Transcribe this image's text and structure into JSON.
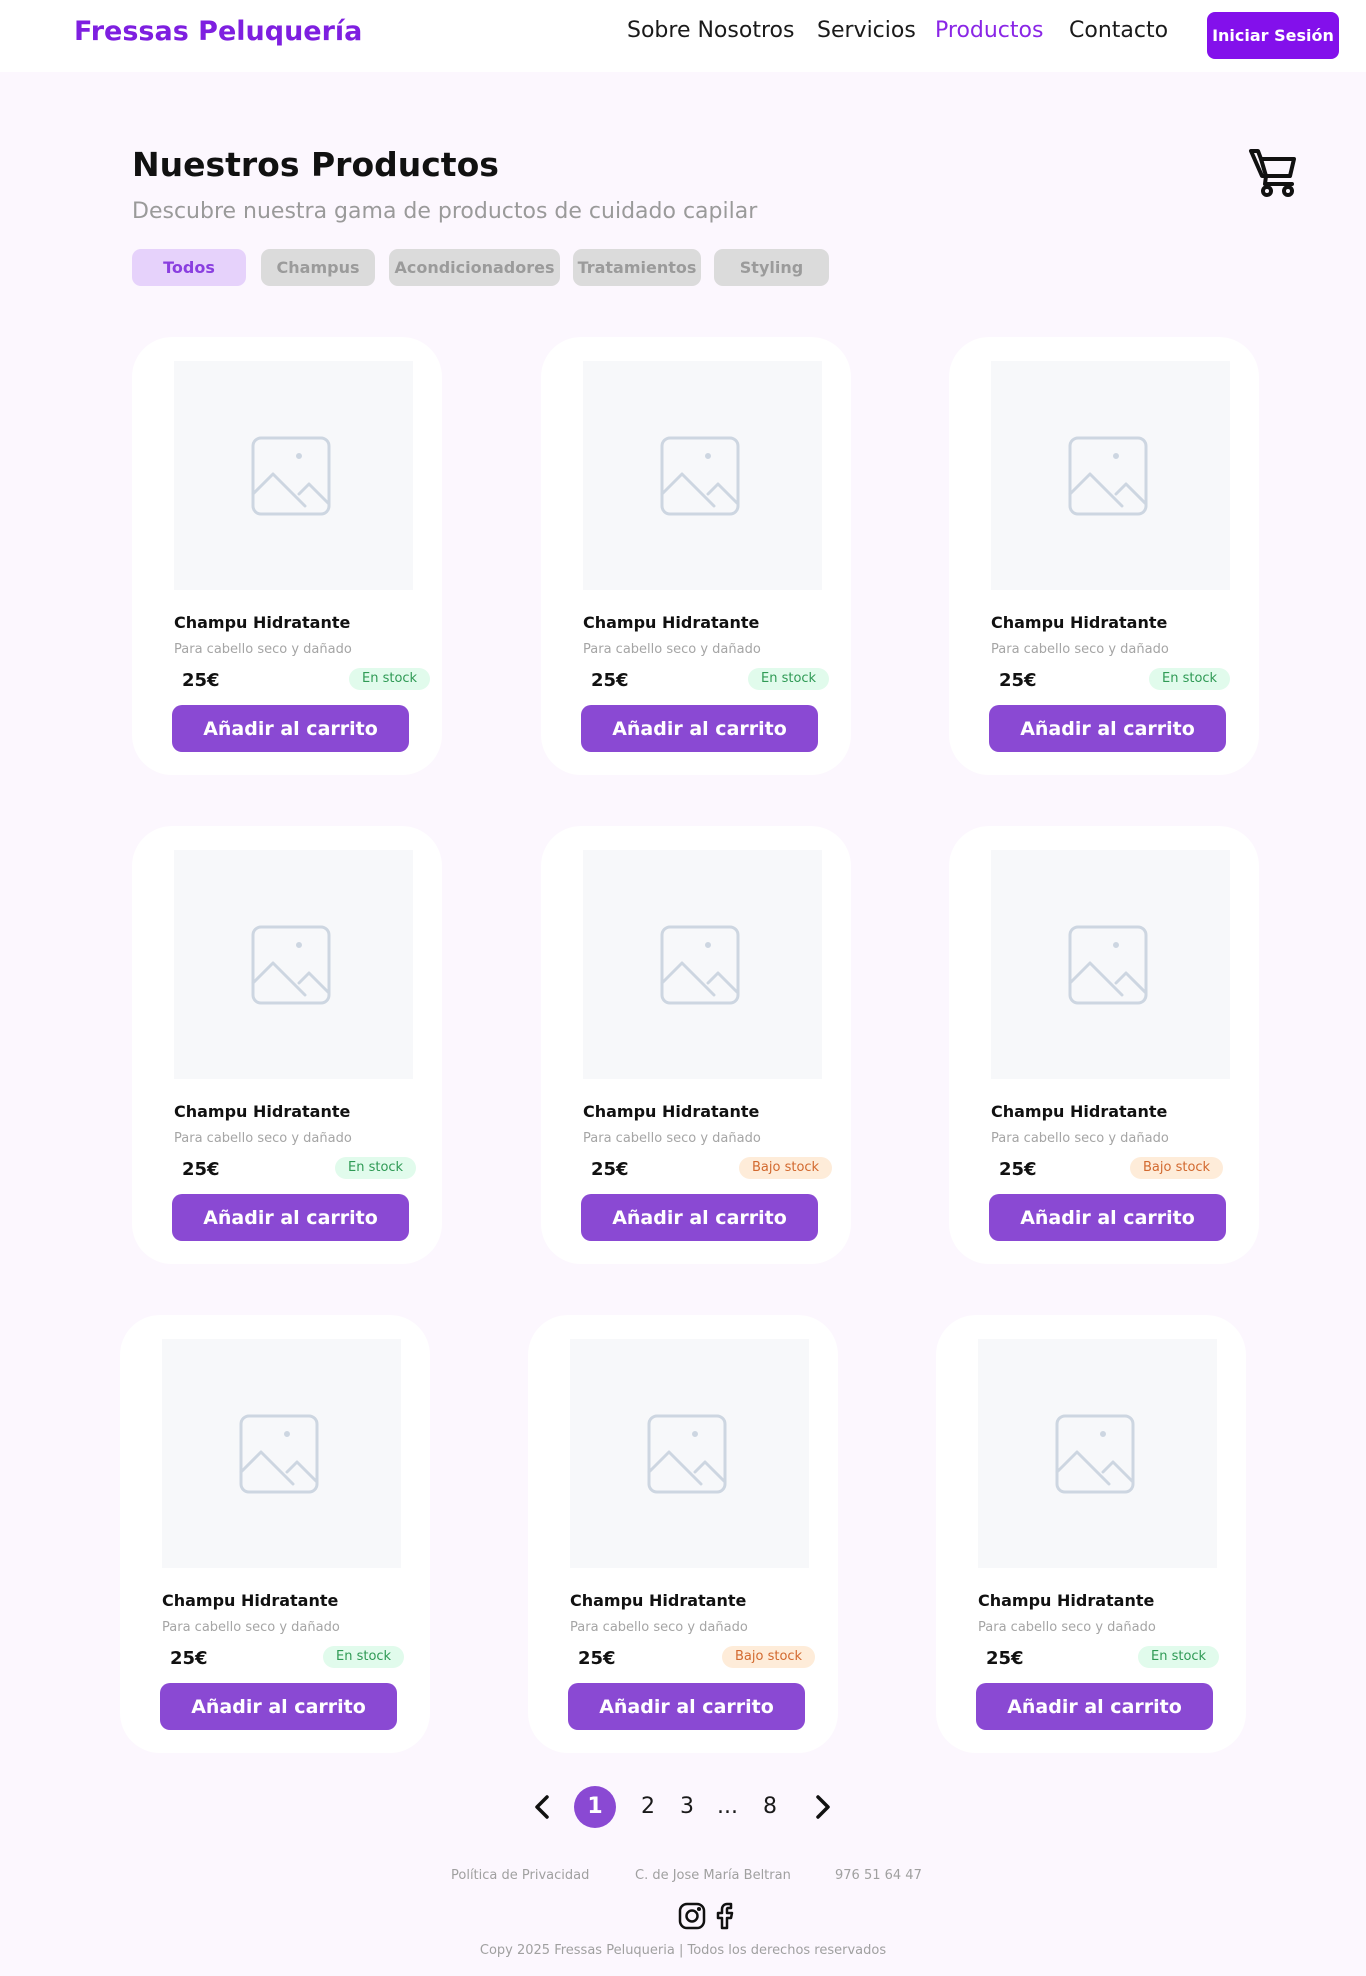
{
  "header": {
    "brand": "Fressas Peluquería",
    "nav": [
      "Sobre Nosotros",
      "Servicios",
      "Productos",
      "Contacto"
    ],
    "active_nav": "Productos",
    "login_label": "Iniciar Sesión",
    "accent_color": "#8310eb"
  },
  "main": {
    "title": "Nuestros Productos",
    "subtitle": "Descubre nuestra gama de productos de cuidado capilar",
    "cart_icon": "cart-icon",
    "filters": [
      "Todos",
      "Champus",
      "Acondicionadores",
      "Tratamientos",
      "Styling"
    ],
    "active_filter": "Todos"
  },
  "products": [
    {
      "name": "Champu Hidratante",
      "description": "Para cabello seco y dañado",
      "price": "25€",
      "stock": "En stock",
      "stock_level": "in",
      "button": "Añadir al carrito"
    },
    {
      "name": "Champu Hidratante",
      "description": "Para cabello seco y dañado",
      "price": "25€",
      "stock": "En stock",
      "stock_level": "in",
      "button": "Añadir al carrito"
    },
    {
      "name": "Champu Hidratante",
      "description": "Para cabello seco y dañado",
      "price": "25€",
      "stock": "En stock",
      "stock_level": "in",
      "button": "Añadir al carrito"
    },
    {
      "name": "Champu Hidratante",
      "description": "Para cabello seco y dañado",
      "price": "25€",
      "stock": "En stock",
      "stock_level": "in",
      "button": "Añadir al carrito"
    },
    {
      "name": "Champu Hidratante",
      "description": "Para cabello seco y dañado",
      "price": "25€",
      "stock": "Bajo stock",
      "stock_level": "low",
      "button": "Añadir al carrito"
    },
    {
      "name": "Champu Hidratante",
      "description": "Para cabello seco y dañado",
      "price": "25€",
      "stock": "Bajo stock",
      "stock_level": "low",
      "button": "Añadir al carrito"
    },
    {
      "name": "Champu Hidratante",
      "description": "Para cabello seco y dañado",
      "price": "25€",
      "stock": "En stock",
      "stock_level": "in",
      "button": "Añadir al carrito"
    },
    {
      "name": "Champu Hidratante",
      "description": "Para cabello seco y dañado",
      "price": "25€",
      "stock": "Bajo stock",
      "stock_level": "low",
      "button": "Añadir al carrito"
    },
    {
      "name": "Champu Hidratante",
      "description": "Para cabello seco y dañado",
      "price": "25€",
      "stock": "En stock",
      "stock_level": "in",
      "button": "Añadir al carrito"
    }
  ],
  "pagination": {
    "pages": [
      "1",
      "2",
      "3"
    ],
    "ellipsis": "...",
    "last": "8",
    "current": "1"
  },
  "footer": {
    "privacy": "Política de Privacidad",
    "address": "C. de Jose María Beltran",
    "phone": "976 51 64 47",
    "social_icons": [
      "instagram-icon",
      "facebook-icon"
    ],
    "copyright": "Copy 2025 Fressas Peluqueria | Todos los derechos reservados"
  }
}
